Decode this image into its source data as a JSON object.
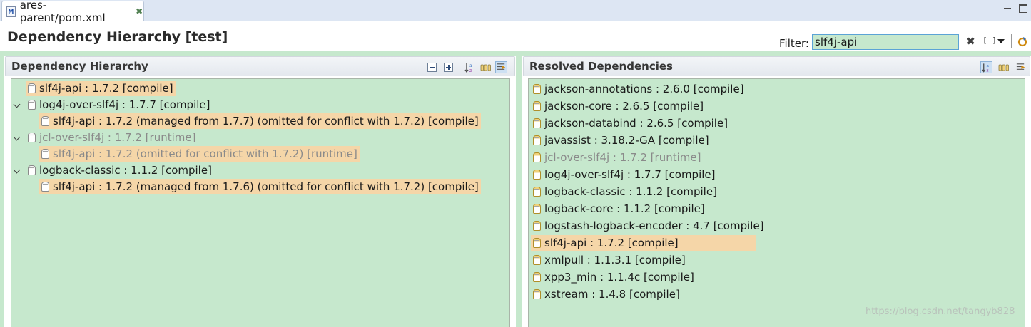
{
  "tab": {
    "label": "ares-parent/pom.xml",
    "icon": "maven-file-icon",
    "badge": "M"
  },
  "page": {
    "title": "Dependency Hierarchy [test]"
  },
  "filter": {
    "label": "Filter:",
    "value": "slf4j-api"
  },
  "colors": {
    "tree_background": "#c6e8cd",
    "conflict_highlight": "#f5d6a8",
    "omitted_text": "#8a8a8a",
    "tab_bar": "#dde6f3"
  },
  "hierarchy": {
    "title": "Dependency Hierarchy",
    "rows": [
      {
        "text": "slf4j-api : 1.7.2 [compile]",
        "depth": 0,
        "expandable": false,
        "highlight": true,
        "omitted": false
      },
      {
        "text": "log4j-over-slf4j : 1.7.7 [compile]",
        "depth": 0,
        "expandable": true,
        "highlight": false,
        "omitted": false
      },
      {
        "text": "slf4j-api : 1.7.2 (managed from 1.7.7) (omitted for conflict with 1.7.2) [compile]",
        "depth": 1,
        "expandable": false,
        "highlight": true,
        "omitted": false
      },
      {
        "text": "jcl-over-slf4j : 1.7.2 [runtime]",
        "depth": 0,
        "expandable": true,
        "highlight": false,
        "omitted": true
      },
      {
        "text": "slf4j-api : 1.7.2 (omitted for conflict with 1.7.2) [runtime]",
        "depth": 1,
        "expandable": false,
        "highlight": true,
        "omitted": true
      },
      {
        "text": "logback-classic : 1.1.2 [compile]",
        "depth": 0,
        "expandable": true,
        "highlight": false,
        "omitted": false
      },
      {
        "text": "slf4j-api : 1.7.2 (managed from 1.7.6) (omitted for conflict with 1.7.2) [compile]",
        "depth": 1,
        "expandable": false,
        "highlight": true,
        "omitted": false
      }
    ]
  },
  "resolved": {
    "title": "Resolved Dependencies",
    "rows": [
      {
        "text": "jackson-annotations : 2.6.0 [compile]",
        "highlight": false,
        "omitted": false
      },
      {
        "text": "jackson-core : 2.6.5 [compile]",
        "highlight": false,
        "omitted": false
      },
      {
        "text": "jackson-databind : 2.6.5 [compile]",
        "highlight": false,
        "omitted": false
      },
      {
        "text": "javassist : 3.18.2-GA [compile]",
        "highlight": false,
        "omitted": false
      },
      {
        "text": "jcl-over-slf4j : 1.7.2 [runtime]",
        "highlight": false,
        "omitted": true
      },
      {
        "text": "log4j-over-slf4j : 1.7.7 [compile]",
        "highlight": false,
        "omitted": false
      },
      {
        "text": "logback-classic : 1.1.2 [compile]",
        "highlight": false,
        "omitted": false
      },
      {
        "text": "logback-core : 1.1.2 [compile]",
        "highlight": false,
        "omitted": false
      },
      {
        "text": "logstash-logback-encoder : 4.7 [compile]",
        "highlight": false,
        "omitted": false
      },
      {
        "text": "slf4j-api : 1.7.2 [compile]",
        "highlight": true,
        "omitted": false
      },
      {
        "text": "xmlpull : 1.1.3.1 [compile]",
        "highlight": false,
        "omitted": false
      },
      {
        "text": "xpp3_min : 1.1.4c [compile]",
        "highlight": false,
        "omitted": false
      },
      {
        "text": "xstream : 1.4.8 [compile]",
        "highlight": false,
        "omitted": false
      }
    ]
  },
  "watermark": "https://blog.csdn.net/tangyb828"
}
